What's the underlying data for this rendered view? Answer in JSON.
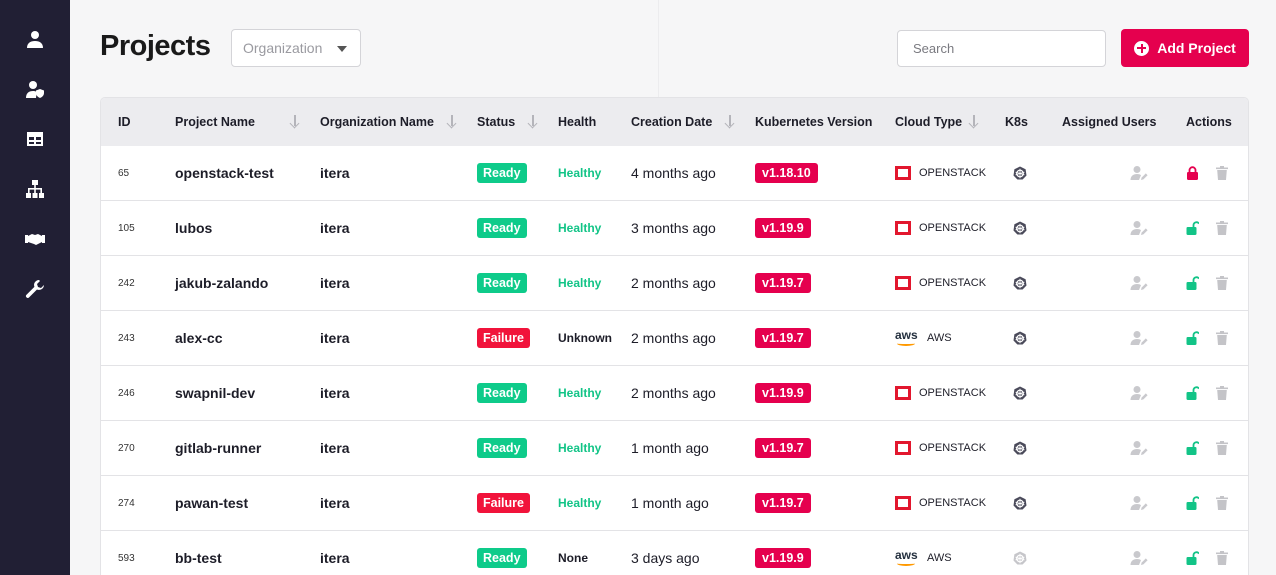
{
  "page_title": "Projects",
  "org_select": {
    "placeholder": "Organization"
  },
  "search": {
    "placeholder": "Search"
  },
  "add_button": {
    "label": "Add Project"
  },
  "sidebar": {
    "items": [
      {
        "icon": "user-icon"
      },
      {
        "icon": "user-shield-icon"
      },
      {
        "icon": "table-icon"
      },
      {
        "icon": "sitemap-icon"
      },
      {
        "icon": "handshake-icon"
      },
      {
        "icon": "wrench-icon"
      }
    ]
  },
  "columns": [
    "ID",
    "Project Name",
    "Organization Name",
    "Status",
    "Health",
    "Creation Date",
    "Kubernetes Version",
    "Cloud Type",
    "K8s",
    "Assigned Users",
    "Actions"
  ],
  "rows": [
    {
      "id": "65",
      "name": "openstack-test",
      "org": "itera",
      "status": "Ready",
      "health": "Healthy",
      "date": "4 months ago",
      "k8s_version": "v1.18.10",
      "cloud": "OPENSTACK",
      "cloud_icon": "openstack-icon",
      "k8s_icon": "kubernetes-icon",
      "lock": "locked"
    },
    {
      "id": "105",
      "name": "lubos",
      "org": "itera",
      "status": "Ready",
      "health": "Healthy",
      "date": "3 months ago",
      "k8s_version": "v1.19.9",
      "cloud": "OPENSTACK",
      "cloud_icon": "openstack-icon",
      "k8s_icon": "kubernetes-icon",
      "lock": "unlocked"
    },
    {
      "id": "242",
      "name": "jakub-zalando",
      "org": "itera",
      "status": "Ready",
      "health": "Healthy",
      "date": "2 months ago",
      "k8s_version": "v1.19.7",
      "cloud": "OPENSTACK",
      "cloud_icon": "openstack-icon",
      "k8s_icon": "kubernetes-icon",
      "lock": "unlocked"
    },
    {
      "id": "243",
      "name": "alex-cc",
      "org": "itera",
      "status": "Failure",
      "health": "Unknown",
      "date": "2 months ago",
      "k8s_version": "v1.19.7",
      "cloud": "AWS",
      "cloud_icon": "aws-icon",
      "k8s_icon": "kubernetes-icon",
      "lock": "unlocked"
    },
    {
      "id": "246",
      "name": "swapnil-dev",
      "org": "itera",
      "status": "Ready",
      "health": "Healthy",
      "date": "2 months ago",
      "k8s_version": "v1.19.9",
      "cloud": "OPENSTACK",
      "cloud_icon": "openstack-icon",
      "k8s_icon": "kubernetes-icon",
      "lock": "unlocked"
    },
    {
      "id": "270",
      "name": "gitlab-runner",
      "org": "itera",
      "status": "Ready",
      "health": "Healthy",
      "date": "1 month ago",
      "k8s_version": "v1.19.7",
      "cloud": "OPENSTACK",
      "cloud_icon": "openstack-icon",
      "k8s_icon": "kubernetes-icon",
      "lock": "unlocked"
    },
    {
      "id": "274",
      "name": "pawan-test",
      "org": "itera",
      "status": "Failure",
      "health": "Healthy",
      "date": "1 month ago",
      "k8s_version": "v1.19.7",
      "cloud": "OPENSTACK",
      "cloud_icon": "openstack-icon",
      "k8s_icon": "kubernetes-icon",
      "lock": "unlocked"
    },
    {
      "id": "593",
      "name": "bb-test",
      "org": "itera",
      "status": "Ready",
      "health": "None",
      "date": "3 days ago",
      "k8s_version": "v1.19.9",
      "cloud": "AWS",
      "cloud_icon": "aws-icon",
      "k8s_icon": "kubernetes-icon-muted",
      "lock": "unlocked"
    }
  ],
  "colors": {
    "accent": "#e5004e",
    "sidebar": "#211f34",
    "ready": "#0ecb8a",
    "failure": "#f1133b",
    "healthy": "#12c487",
    "lock_locked": "#e5004e",
    "lock_unlocked": "#12c487"
  }
}
